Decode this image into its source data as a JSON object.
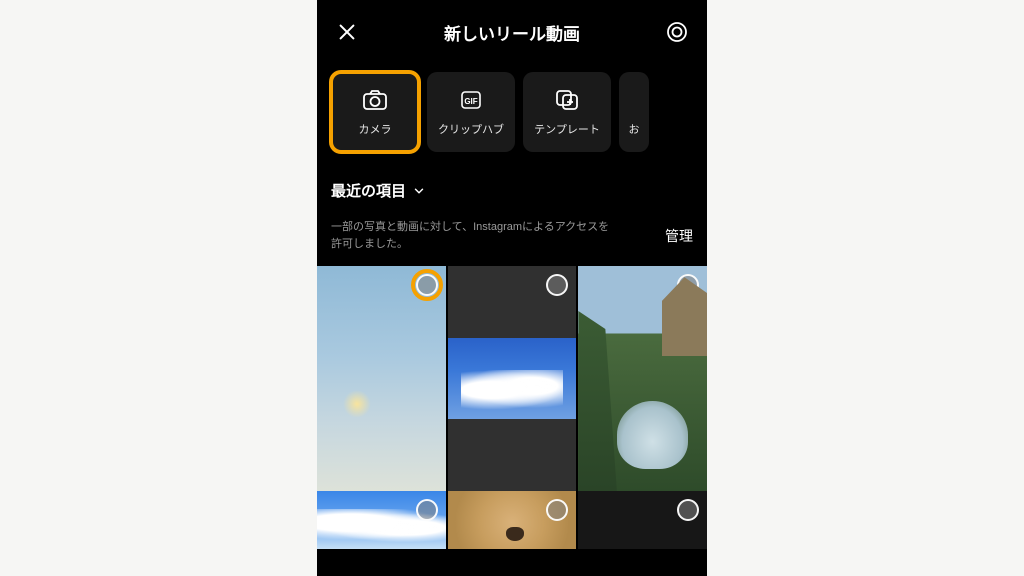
{
  "header": {
    "title": "新しいリール動画"
  },
  "tabs": [
    {
      "label": "カメラ",
      "icon": "camera",
      "highlighted": true
    },
    {
      "label": "クリップハブ",
      "icon": "gif",
      "highlighted": false
    },
    {
      "label": "テンプレート",
      "icon": "template",
      "highlighted": false
    },
    {
      "label": "お",
      "icon": "",
      "highlighted": false
    }
  ],
  "album_selector": {
    "label": "最近の項目"
  },
  "permission": {
    "text": "一部の写真と動画に対して、Instagramによるアクセスを許可しました。",
    "manage_label": "管理"
  },
  "gallery": [
    {
      "kind": "sky-halo",
      "selector_highlighted": true
    },
    {
      "kind": "clouds-inset",
      "selector_highlighted": false
    },
    {
      "kind": "garden-fountain",
      "selector_highlighted": false
    },
    {
      "kind": "blue-sky-clouds",
      "selector_highlighted": false
    },
    {
      "kind": "dog",
      "selector_highlighted": false
    },
    {
      "kind": "dark",
      "selector_highlighted": false
    }
  ]
}
